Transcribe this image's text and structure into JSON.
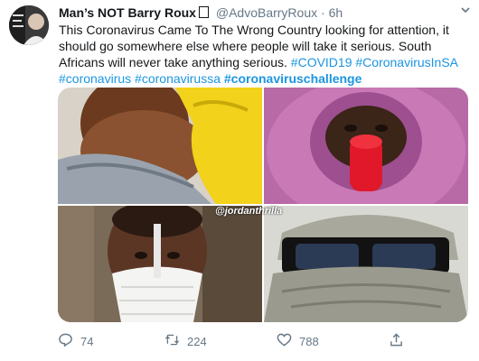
{
  "author": {
    "name": "Man’s NOT Barry Roux",
    "handle": "@AdvoBarryRoux",
    "separator": "·",
    "time": "6h"
  },
  "tweet": {
    "text": "This Coronavirus Came To The Wrong Country looking for attention, it should go somewhere else where people will take it serious. South Africans will never take anything serious.",
    "hashtags": [
      "#COVID19",
      "#CoronavirusInSA",
      "#coronavirus",
      "#coronavirussa",
      "#coronaviruschallenge"
    ]
  },
  "media": {
    "watermark": "@jordanthrilla"
  },
  "actions": {
    "replies": "74",
    "retweets": "224",
    "likes": "788"
  },
  "icons": [
    "reply-icon",
    "retweet-icon",
    "like-icon",
    "share-icon",
    "chevron-down-icon"
  ],
  "colors": {
    "link": "#1b95e0",
    "muted": "#657786",
    "text": "#14171a"
  }
}
